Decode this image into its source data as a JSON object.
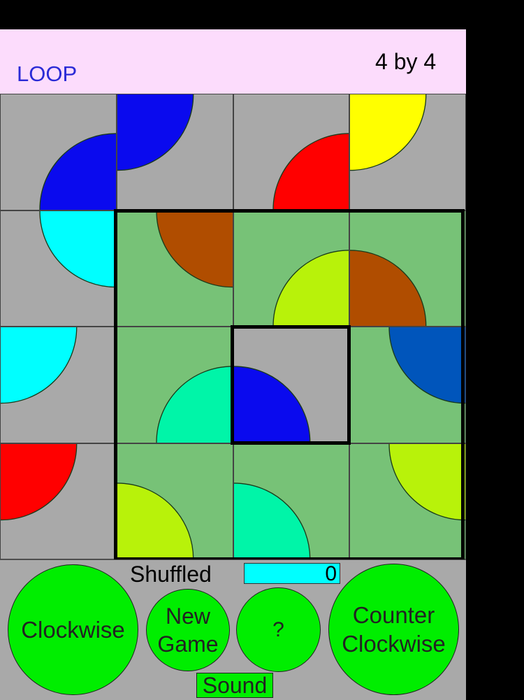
{
  "header": {
    "title": "LOOP",
    "size_label": "4 by 4"
  },
  "colors": {
    "header_bg": "#fcdcfc",
    "gray_tile": "#a9a9a9",
    "green_tile": "#77c277",
    "button": "#00ee00",
    "counter_bg": "#00ffff"
  },
  "board": {
    "rows": 4,
    "cols": 4,
    "tiles": [
      {
        "row": 0,
        "col": 0,
        "bg": "gray",
        "corner": "bottom-right",
        "color": "#0a0aee"
      },
      {
        "row": 0,
        "col": 1,
        "bg": "gray",
        "corner": "top-left",
        "color": "#0a0aee"
      },
      {
        "row": 0,
        "col": 2,
        "bg": "gray",
        "corner": "bottom-right",
        "color": "#ff0000"
      },
      {
        "row": 0,
        "col": 3,
        "bg": "gray",
        "corner": "top-left",
        "color": "#ffff00"
      },
      {
        "row": 1,
        "col": 0,
        "bg": "gray",
        "corner": "top-right",
        "color": "#00ffff"
      },
      {
        "row": 1,
        "col": 1,
        "bg": "green",
        "corner": "top-right",
        "color": "#b04d00"
      },
      {
        "row": 1,
        "col": 2,
        "bg": "green",
        "corner": "bottom-right",
        "color": "#b8f20a"
      },
      {
        "row": 1,
        "col": 3,
        "bg": "green",
        "corner": "bottom-left",
        "color": "#b04d00"
      },
      {
        "row": 2,
        "col": 0,
        "bg": "gray",
        "corner": "top-left",
        "color": "#00ffff"
      },
      {
        "row": 2,
        "col": 1,
        "bg": "green",
        "corner": "bottom-right",
        "color": "#00f5a8"
      },
      {
        "row": 2,
        "col": 2,
        "bg": "gray",
        "corner": "bottom-left",
        "color": "#0a0aee"
      },
      {
        "row": 2,
        "col": 3,
        "bg": "green",
        "corner": "top-right",
        "color": "#0055bb"
      },
      {
        "row": 3,
        "col": 0,
        "bg": "gray",
        "corner": "top-left",
        "color": "#ff0000"
      },
      {
        "row": 3,
        "col": 1,
        "bg": "green",
        "corner": "bottom-left",
        "color": "#b8f20a"
      },
      {
        "row": 3,
        "col": 2,
        "bg": "green",
        "corner": "bottom-left",
        "color": "#00f5a8"
      },
      {
        "row": 3,
        "col": 3,
        "bg": "green",
        "corner": "top-right",
        "color": "#b8f20a"
      }
    ]
  },
  "controls": {
    "shuffled_label": "Shuffled",
    "shuffled_count": "0",
    "clockwise_label": "Clockwise",
    "new_game_label": "New\nGame",
    "help_label": "?",
    "counter_clockwise_label": "Counter\nClockwise",
    "sound_label": "Sound"
  }
}
